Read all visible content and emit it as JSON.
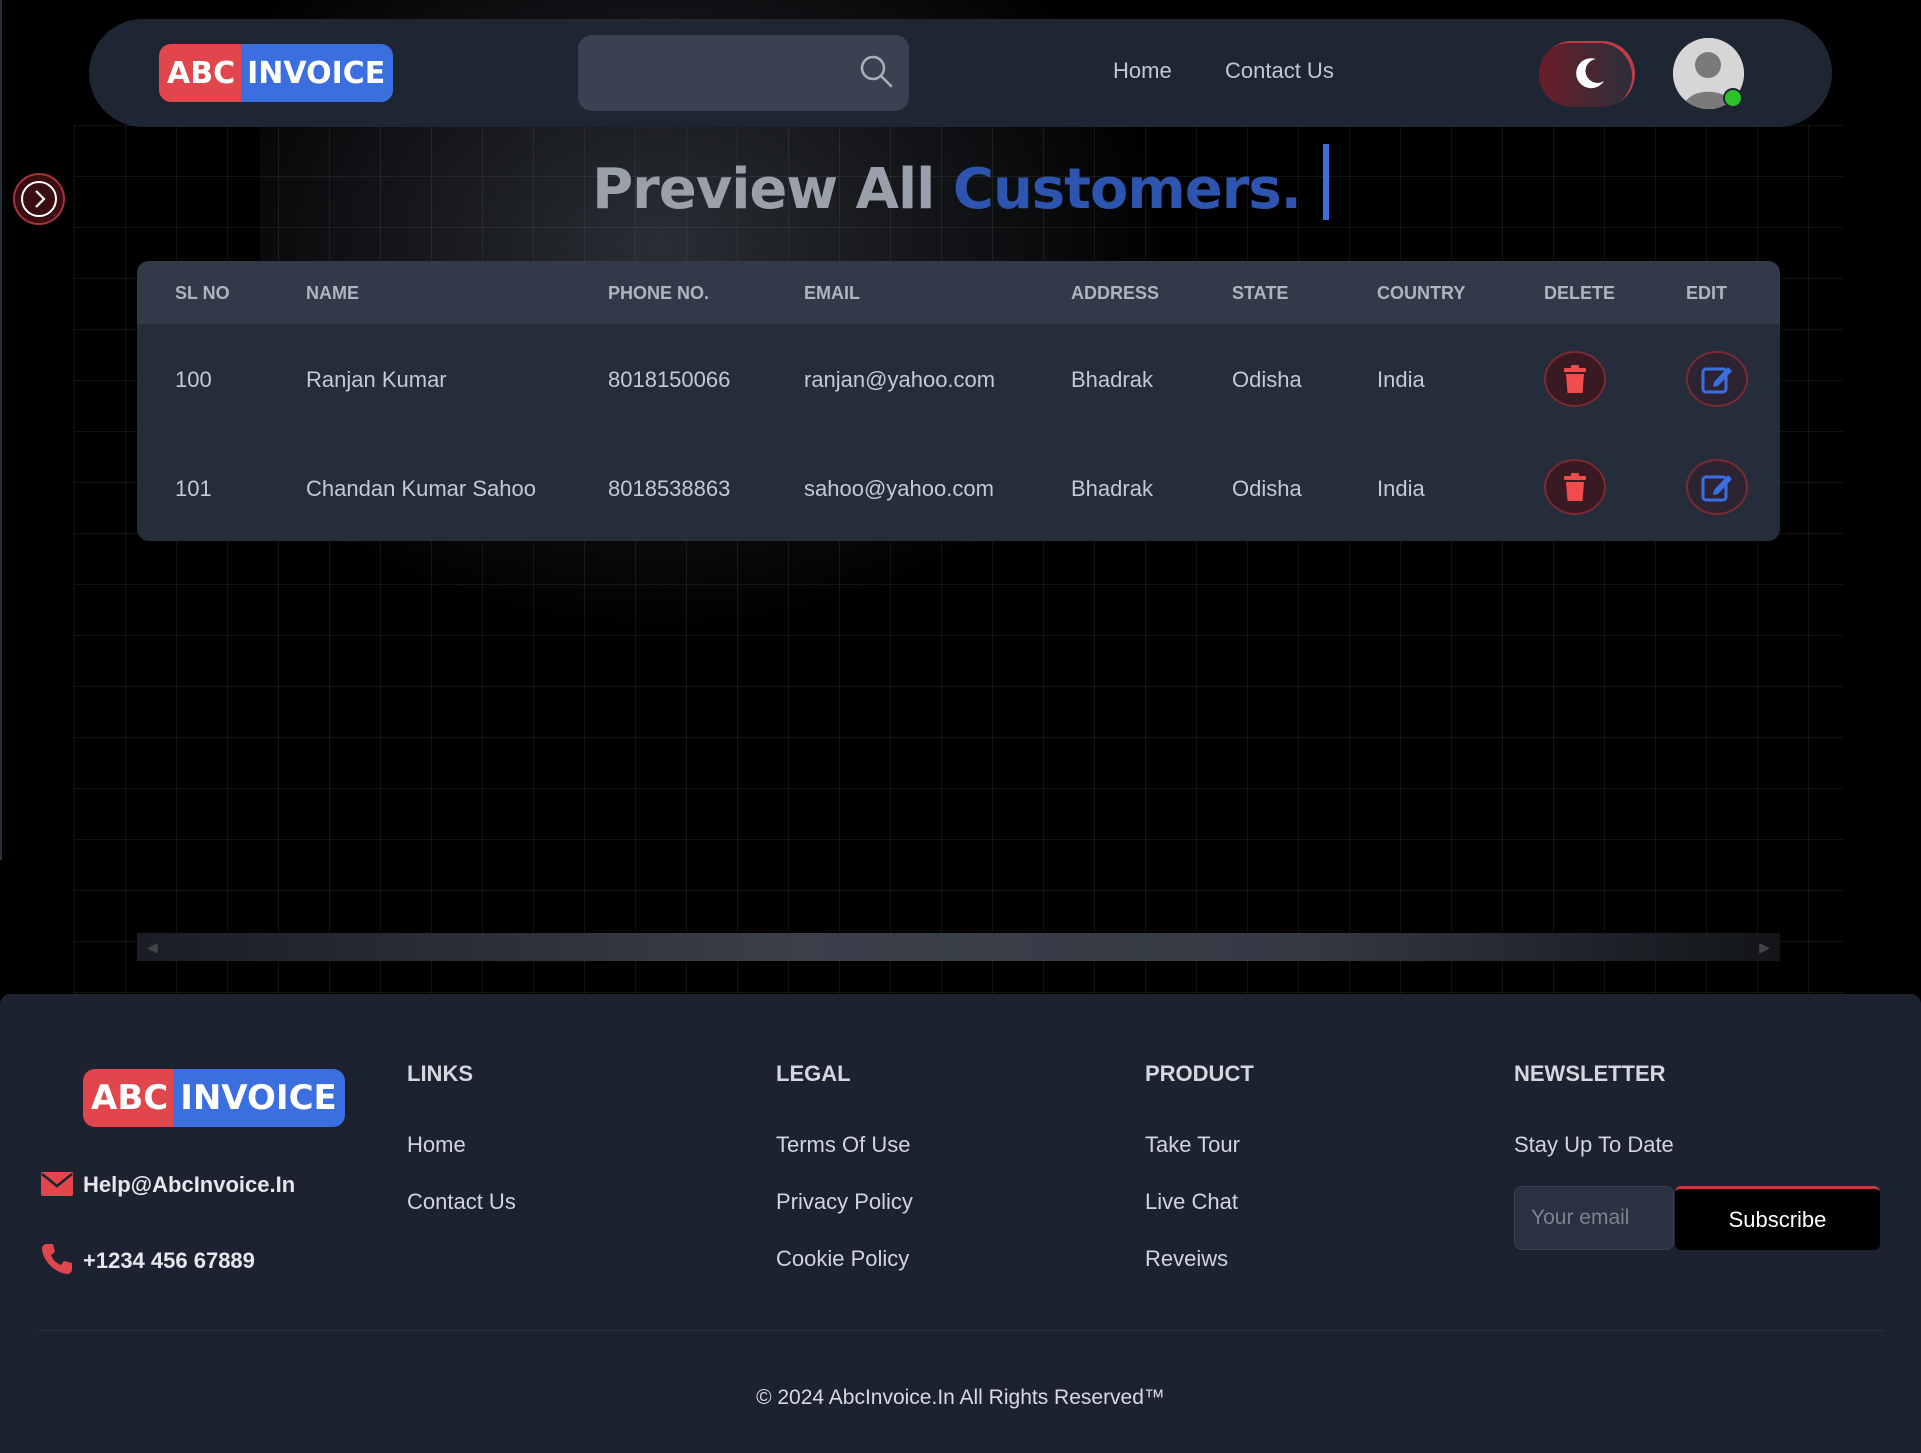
{
  "brand": {
    "logo_part1": "ABC",
    "logo_part2": "INVOICE"
  },
  "header": {
    "search": {
      "placeholder": "",
      "value": ""
    },
    "nav": [
      {
        "label": "Home"
      },
      {
        "label": "Contact Us"
      }
    ],
    "theme": "dark",
    "user_status": "online"
  },
  "page": {
    "title_part1": "Preview All",
    "title_part2": "Customers."
  },
  "table": {
    "columns": [
      "SL NO",
      "NAME",
      "PHONE NO.",
      "EMAIL",
      "ADDRESS",
      "STATE",
      "COUNTRY",
      "DELETE",
      "EDIT"
    ],
    "rows": [
      {
        "sl_no": "100",
        "name": "Ranjan Kumar",
        "phone": "8018150066",
        "email": "ranjan@yahoo.com",
        "address": "Bhadrak",
        "state": "Odisha",
        "country": "India"
      },
      {
        "sl_no": "101",
        "name": "Chandan Kumar Sahoo",
        "phone": "8018538863",
        "email": "sahoo@yahoo.com",
        "address": "Bhadrak",
        "state": "Odisha",
        "country": "India"
      }
    ]
  },
  "footer": {
    "contact": {
      "email": "Help@AbcInvoice.In",
      "phone": "+1234 456 67889"
    },
    "columns": [
      {
        "heading": "LINKS",
        "items": [
          "Home",
          "Contact Us"
        ]
      },
      {
        "heading": "LEGAL",
        "items": [
          "Terms Of Use",
          "Privacy Policy",
          "Cookie Policy"
        ]
      },
      {
        "heading": "PRODUCT",
        "items": [
          "Take Tour",
          "Live Chat",
          "Reveiws"
        ]
      }
    ],
    "newsletter": {
      "heading": "NEWSLETTER",
      "subtitle": "Stay Up To Date",
      "placeholder": "Your email",
      "button": "Subscribe"
    },
    "copyright": "© 2024 AbcInvoice.In All Rights Reserved™"
  },
  "colors": {
    "background": "#000000",
    "navbar": "#1e2533",
    "accent_blue": "#3b6fe0",
    "accent_red": "#e0464c",
    "footer": "#1c2230"
  }
}
